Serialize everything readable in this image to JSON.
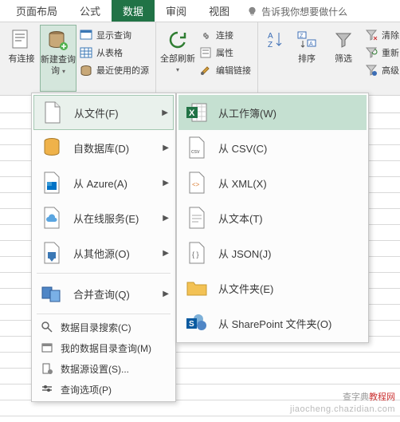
{
  "tabs": {
    "page_layout": "页面布局",
    "formulas": "公式",
    "data": "数据",
    "review": "审阅",
    "view": "视图"
  },
  "tell_me": "告诉我你想要做什么",
  "ribbon": {
    "existing_conn": "有连接",
    "new_query": "新建查询",
    "new_query_sub": "询",
    "show_queries": "显示查询",
    "from_table": "从表格",
    "recent_sources": "最近使用的源",
    "refresh_all": "全部刷新",
    "connections": "连接",
    "properties": "属性",
    "edit_links": "编辑链接",
    "sort": "排序",
    "filter": "筛选",
    "clear": "清除",
    "reapply": "重新",
    "advanced": "高级"
  },
  "menu1": {
    "from_file": "从文件(F)",
    "from_db": "自数据库(D)",
    "from_azure": "从 Azure(A)",
    "from_online": "从在线服务(E)",
    "from_other": "从其他源(O)",
    "combine": "合并查询(Q)",
    "catalog_search": "数据目录搜索(C)",
    "my_catalog": "我的数据目录查询(M)",
    "source_settings": "数据源设置(S)...",
    "query_options": "查询选项(P)"
  },
  "menu2": {
    "from_workbook": "从工作簿(W)",
    "from_csv": "从 CSV(C)",
    "from_xml": "从 XML(X)",
    "from_text": "从文本(T)",
    "from_json": "从 JSON(J)",
    "from_folder": "从文件夹(E)",
    "from_sharepoint": "从 SharePoint 文件夹(O)"
  },
  "watermark": {
    "a": "查字典",
    "b": "教程网",
    "c": "jiaocheng.chazidian.com"
  },
  "colors": {
    "accent": "#217346"
  }
}
